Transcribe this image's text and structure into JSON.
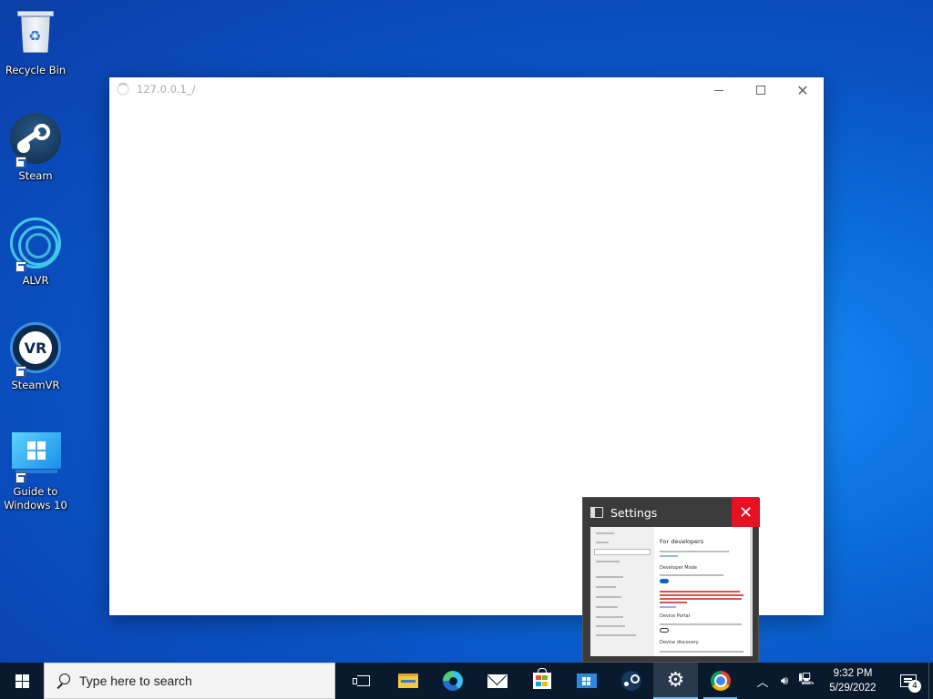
{
  "desktop": {
    "icons": [
      {
        "label": "Recycle Bin",
        "icon": "recycle-bin-icon"
      },
      {
        "label": "Steam",
        "icon": "steam-icon"
      },
      {
        "label": "ALVR",
        "icon": "alvr-icon"
      },
      {
        "label": "SteamVR",
        "icon": "steamvr-icon",
        "logo_text": "VR"
      },
      {
        "label": "Guide to Windows 10",
        "icon": "windows-guide-icon"
      }
    ]
  },
  "browser_window": {
    "title": "127.0.0.1_/",
    "status": "loading"
  },
  "settings_preview": {
    "title": "Settings",
    "thumbnail": {
      "heading": "For developers",
      "section_1": "Developer Mode",
      "section_2": "Device Portal",
      "section_3": "Device discovery"
    }
  },
  "taskbar": {
    "search_placeholder": "Type here to search",
    "apps": [
      {
        "name": "Task View",
        "icon": "task-view-icon"
      },
      {
        "name": "File Explorer",
        "icon": "folder-icon"
      },
      {
        "name": "Microsoft Edge",
        "icon": "edge-icon"
      },
      {
        "name": "Mail",
        "icon": "mail-icon"
      },
      {
        "name": "Microsoft Store",
        "icon": "store-icon"
      },
      {
        "name": "Guide to Windows 10",
        "icon": "windows-guide-icon"
      },
      {
        "name": "Steam",
        "icon": "steam-icon"
      },
      {
        "name": "Settings",
        "icon": "gear-icon",
        "active": true
      },
      {
        "name": "Google Chrome",
        "icon": "chrome-icon",
        "open": true
      }
    ],
    "clock": {
      "time": "9:32 PM",
      "date": "5/29/2022"
    },
    "notification_count": "4"
  },
  "colors": {
    "taskbar_bg": "#0a1a2e",
    "accent": "#76b9ed",
    "close_red": "#e81123"
  }
}
